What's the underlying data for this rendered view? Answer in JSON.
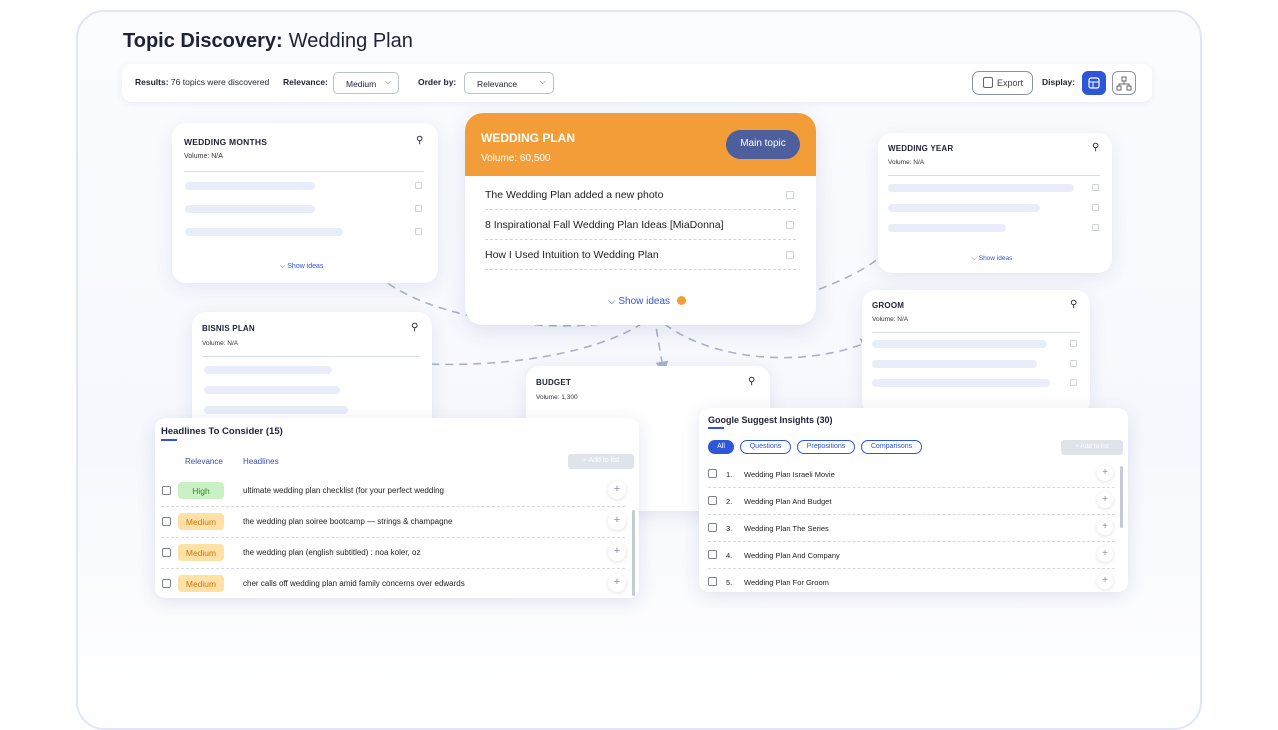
{
  "page": {
    "title_bold": "Topic Discovery:",
    "title_rest": "Wedding Plan"
  },
  "toolbar": {
    "results_label": "Results:",
    "results_value": "76 topics were discovered",
    "relevance_label": "Relevance:",
    "relevance_value": "Medium",
    "order_label": "Order by:",
    "order_value": "Relevance",
    "export_label": "Export",
    "display_label": "Display:",
    "display_modes": [
      "grid-icon",
      "hierarchy-icon"
    ],
    "accent": "#2e56d8"
  },
  "main_topic": {
    "name": "WEDDING PLAN",
    "volume": "Volume: 60,500",
    "badge": "Main topic",
    "items": [
      "The Wedding Plan added a new photo",
      "8 Inspirational Fall Wedding Plan Ideas [MiaDonna]",
      "How I Used Intuition to Wedding Plan"
    ],
    "show_ideas": "Show ideas",
    "color": "#f29d38"
  },
  "subtopics": {
    "wedding_months": {
      "name": "WEDDING MONTHS",
      "volume": "Volume: N/A",
      "show_ideas": "Show ideas"
    },
    "wedding_year": {
      "name": "WEDDING YEAR",
      "volume": "Volume: N/A",
      "show_ideas": "Show ideas"
    },
    "bisnis_plan": {
      "name": "BISNIS PLAN",
      "volume": "Volume: N/A"
    },
    "groom": {
      "name": "GROOM",
      "volume": "Volume: N/A"
    },
    "budget": {
      "name": "BUDGET",
      "volume": "Volume: 1,300"
    }
  },
  "headlines": {
    "title": "Headlines To Consider (15)",
    "col_relevance": "Relevance",
    "col_headlines": "Headlines",
    "add_to_list": "Add to list",
    "rows": [
      {
        "relevance": "High",
        "text": "ultimate wedding plan checklist (for your perfect wedding"
      },
      {
        "relevance": "Medium",
        "text": "the wedding plan soiree bootcamp — strings & champagne"
      },
      {
        "relevance": "Medium",
        "text": "the wedding plan (english subtitled) : noa koler, oz"
      },
      {
        "relevance": "Medium",
        "text": "cher calls off wedding plan amid family concerns over edwards"
      }
    ],
    "high_color": "#c9f1c3",
    "medium_color": "#ffe1a6"
  },
  "google": {
    "title": "Google Suggest Insights (30)",
    "filters": [
      "All",
      "Questions",
      "Prepositions",
      "Comparisons"
    ],
    "add_to_list": "Add to list",
    "rows": [
      {
        "num": "1.",
        "text": "Wedding Plan Israeli Movie"
      },
      {
        "num": "2.",
        "text": "Wedding Plan And Budget"
      },
      {
        "num": "3.",
        "text": "Wedding Plan The Series"
      },
      {
        "num": "4.",
        "text": "Wedding Plan And Company"
      },
      {
        "num": "5.",
        "text": "Wedding Plan For Groom"
      }
    ]
  }
}
